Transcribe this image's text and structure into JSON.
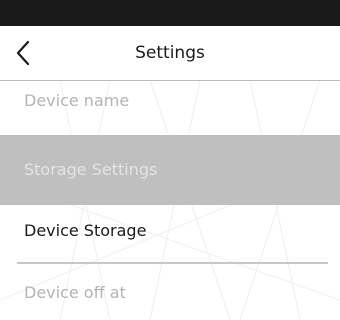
{
  "status_bar": {
    "color": "#1a1a1a"
  },
  "header": {
    "title": "Settings",
    "back_icon": "chevron-left-icon"
  },
  "items": {
    "device_name": "Device name",
    "section_storage": "Storage Settings",
    "device_storage": "Device Storage",
    "device_off_at": "Device off at"
  },
  "colors": {
    "section_header_bg": "#bfbfbf",
    "muted_text": "#b3b3b3",
    "primary_text": "#1a1a1a"
  }
}
